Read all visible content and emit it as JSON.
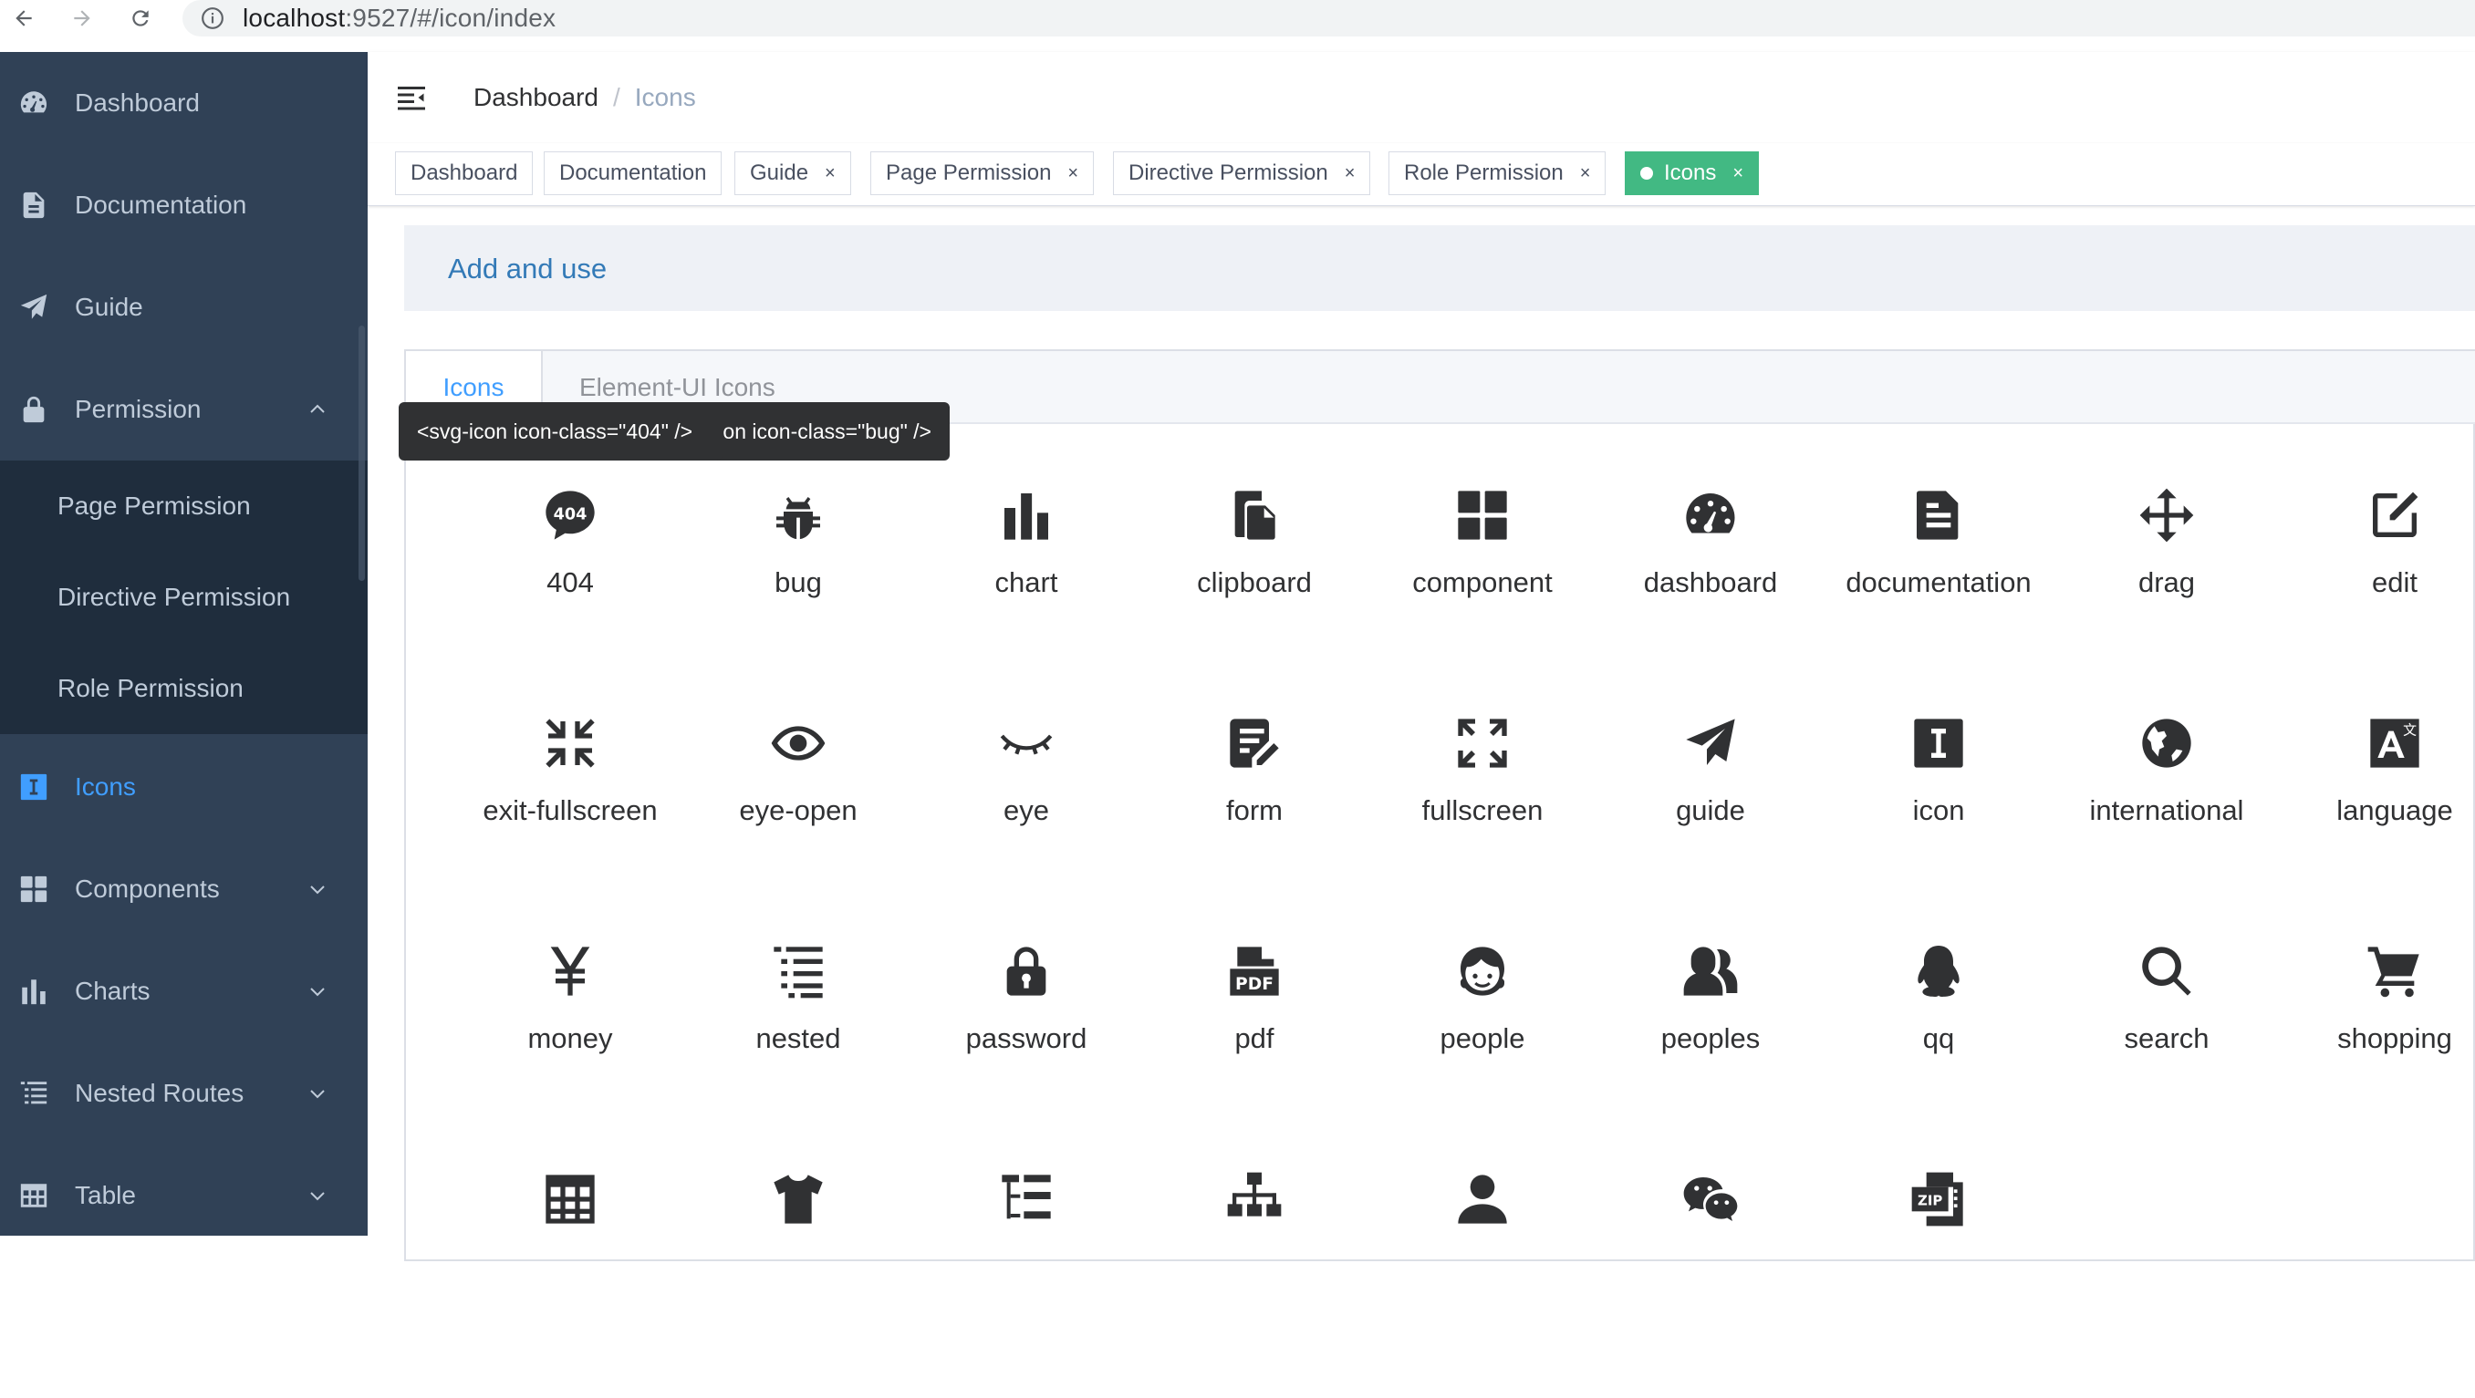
{
  "browser": {
    "url_host": "localhost",
    "url_rest": ":9527/#/icon/index"
  },
  "sidebar": {
    "items": [
      {
        "label": "Dashboard",
        "icon": "dashboard-icon"
      },
      {
        "label": "Documentation",
        "icon": "documentation-icon"
      },
      {
        "label": "Guide",
        "icon": "guide-icon"
      },
      {
        "label": "Permission",
        "icon": "lock-icon",
        "expanded": true,
        "children": [
          {
            "label": "Page Permission"
          },
          {
            "label": "Directive Permission"
          },
          {
            "label": "Role Permission"
          }
        ]
      },
      {
        "label": "Icons",
        "icon": "icon-icon",
        "active": true
      },
      {
        "label": "Components",
        "icon": "component-icon"
      },
      {
        "label": "Charts",
        "icon": "chart-icon"
      },
      {
        "label": "Nested Routes",
        "icon": "nested-icon"
      },
      {
        "label": "Table",
        "icon": "table-icon"
      }
    ]
  },
  "breadcrumb": {
    "first": "Dashboard",
    "separator": "/",
    "last": "Icons"
  },
  "tags": [
    {
      "label": "Dashboard",
      "closable": false
    },
    {
      "label": "Documentation",
      "closable": false
    },
    {
      "label": "Guide",
      "closable": true
    },
    {
      "label": "Page Permission",
      "closable": true
    },
    {
      "label": "Directive Permission",
      "closable": true
    },
    {
      "label": "Role Permission",
      "closable": true
    },
    {
      "label": "Icons",
      "closable": true,
      "active": true
    }
  ],
  "tag_close_glyph": "×",
  "banner": {
    "link": "Add and use"
  },
  "tabs": [
    {
      "label": "Icons",
      "active": true
    },
    {
      "label": "Element-UI Icons",
      "active": false
    }
  ],
  "tooltips": [
    {
      "text": "<svg-icon icon-class=\"bug\" />"
    },
    {
      "text": "<svg-icon icon-class=\"404\" />"
    }
  ],
  "icons": [
    "404",
    "bug",
    "chart",
    "clipboard",
    "component",
    "dashboard",
    "documentation",
    "drag",
    "edit",
    "exit-fullscreen",
    "eye-open",
    "eye",
    "form",
    "fullscreen",
    "guide",
    "icon",
    "international",
    "language",
    "money",
    "nested",
    "password",
    "pdf",
    "people",
    "peoples",
    "qq",
    "search",
    "shopping",
    "table",
    "tshirt",
    "tree-table",
    "tree",
    "user",
    "wechat",
    "zip"
  ],
  "colors": {
    "sidebar_bg": "#304156",
    "submenu_bg": "#1f2d3d",
    "sidebar_text": "#bfcbd9",
    "active": "#409eff",
    "tag_active": "#42b983"
  }
}
